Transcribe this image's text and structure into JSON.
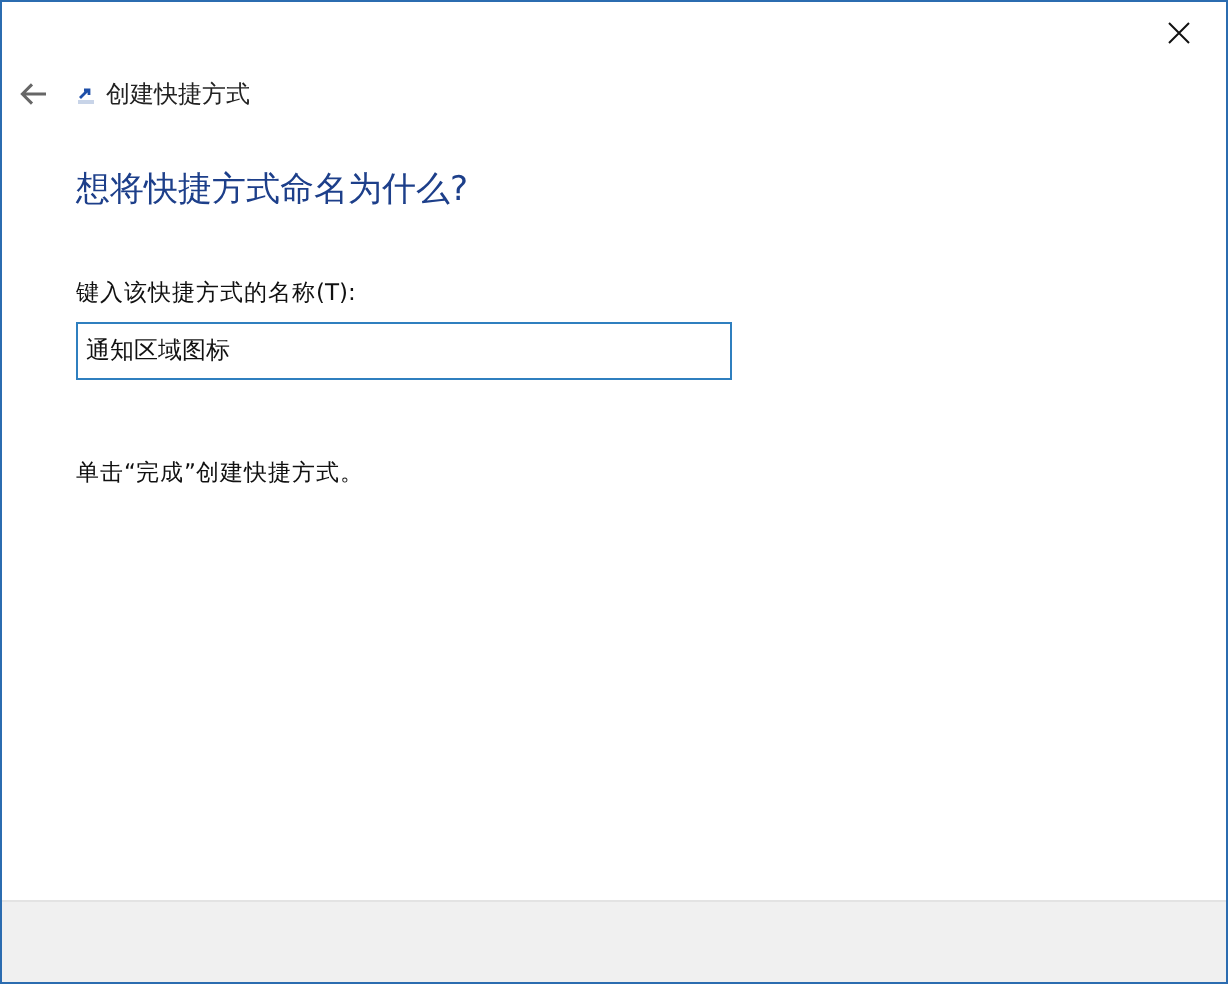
{
  "window": {
    "title": "创建快捷方式"
  },
  "heading": "想将快捷方式命名为什么?",
  "name_field": {
    "label": "键入该快捷方式的名称(T):",
    "value": "通知区域图标"
  },
  "instruction": "单击“完成”创建快捷方式。"
}
